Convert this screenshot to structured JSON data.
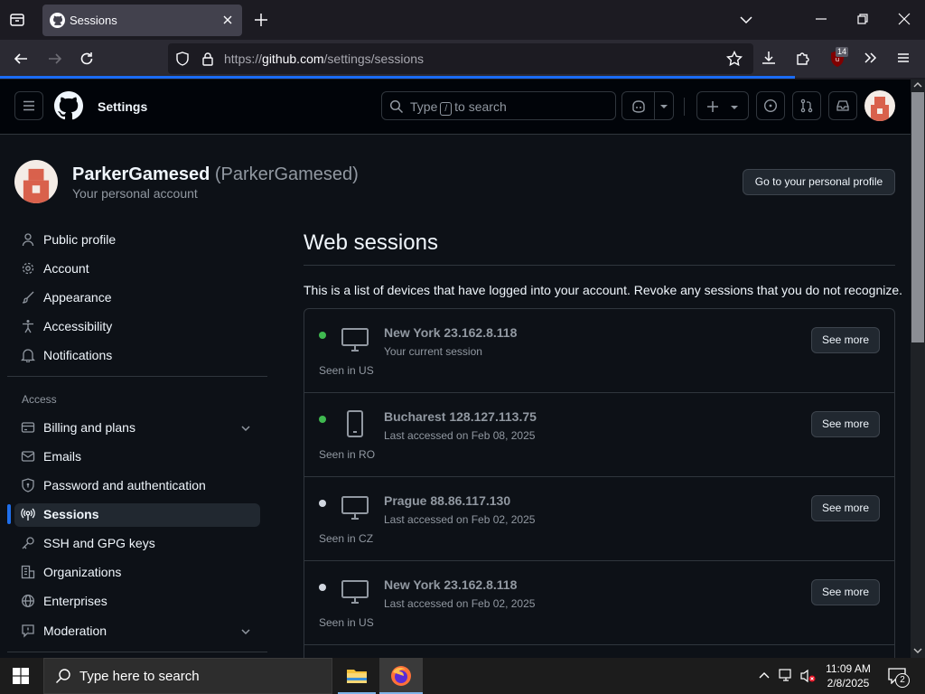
{
  "browser": {
    "tab_title": "Sessions",
    "url_prefix": "https://",
    "url_domain": "github.com",
    "url_path": "/settings/sessions",
    "ext_badge": "14"
  },
  "header": {
    "title": "Settings",
    "search_type": "Type",
    "search_key": "/",
    "search_rest": "to search"
  },
  "account": {
    "name": "ParkerGamesed",
    "handle": "(ParkerGamesed)",
    "subtitle": "Your personal account",
    "profile_button": "Go to your personal profile"
  },
  "sidebar": {
    "items": [
      {
        "label": "Public profile",
        "icon": "person-icon"
      },
      {
        "label": "Account",
        "icon": "gear-icon"
      },
      {
        "label": "Appearance",
        "icon": "paintbrush-icon"
      },
      {
        "label": "Accessibility",
        "icon": "accessibility-icon"
      },
      {
        "label": "Notifications",
        "icon": "bell-icon"
      }
    ],
    "section_access": "Access",
    "access_items": [
      {
        "label": "Billing and plans",
        "icon": "credit-card-icon"
      },
      {
        "label": "Emails",
        "icon": "mail-icon"
      },
      {
        "label": "Password and authentication",
        "icon": "shield-lock-icon"
      },
      {
        "label": "Sessions",
        "icon": "broadcast-icon"
      },
      {
        "label": "SSH and GPG keys",
        "icon": "key-icon"
      },
      {
        "label": "Organizations",
        "icon": "organization-icon"
      },
      {
        "label": "Enterprises",
        "icon": "globe-icon"
      },
      {
        "label": "Moderation",
        "icon": "report-icon"
      }
    ]
  },
  "main": {
    "heading": "Web sessions",
    "description": "This is a list of devices that have logged into your account. Revoke any sessions that you do not recognize.",
    "sessions": [
      {
        "location": "New York 23.162.8.118",
        "detail": "Your current session",
        "seen": "Seen in US",
        "device": "desktop-icon",
        "status": "active",
        "button": "See more"
      },
      {
        "location": "Bucharest 128.127.113.75",
        "detail": "Last accessed on Feb 08, 2025",
        "seen": "Seen in RO",
        "device": "mobile-icon",
        "status": "active",
        "button": "See more"
      },
      {
        "location": "Prague 88.86.117.130",
        "detail": "Last accessed on Feb 02, 2025",
        "seen": "Seen in CZ",
        "device": "desktop-icon",
        "status": "inactive",
        "button": "See more"
      },
      {
        "location": "New York 23.162.8.118",
        "detail": "Last accessed on Feb 02, 2025",
        "seen": "Seen in US",
        "device": "desktop-icon",
        "status": "inactive",
        "button": "See more"
      }
    ]
  },
  "colors": {
    "active_dot": "#3fb950",
    "inactive_dot": "#d1d7e0",
    "accent": "#1f6feb"
  },
  "taskbar": {
    "search_placeholder": "Type here to search",
    "time": "11:09 AM",
    "date": "2/8/2025",
    "notification_count": "2"
  }
}
